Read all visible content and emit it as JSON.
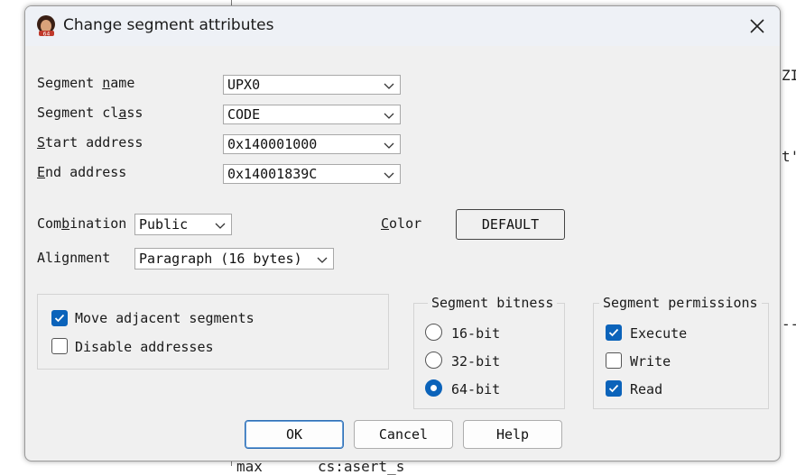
{
  "background": {
    "fragments": [
      "ZI",
      "t'",
      "--",
      "max",
      "cs:asert_s"
    ]
  },
  "dialog": {
    "title": "Change segment attributes",
    "fields": {
      "segment_name": {
        "label_pre": "Segment ",
        "label_u": "n",
        "label_post": "ame",
        "value": "UPX0"
      },
      "segment_class": {
        "label_pre": "Segment cl",
        "label_u": "a",
        "label_post": "ss",
        "value": "CODE"
      },
      "start_address": {
        "label_pre": "",
        "label_u": "S",
        "label_post": "tart address",
        "value": "0x140001000"
      },
      "end_address": {
        "label_pre": "",
        "label_u": "E",
        "label_post": "nd address",
        "value": "0x14001839C"
      }
    },
    "combination": {
      "label_pre": "Com",
      "label_u": "b",
      "label_post": "ination",
      "value": "Public"
    },
    "alignment": {
      "label": "Alignment",
      "value": "Paragraph (16 bytes)"
    },
    "color": {
      "label_u": "C",
      "label_post": "olor",
      "button": "DEFAULT"
    },
    "options": {
      "move_adjacent": {
        "label": "Move adjacent segments",
        "checked": true
      },
      "disable_addresses": {
        "label": "Disable addresses",
        "checked": false
      }
    },
    "bitness": {
      "title": "Segment bitness",
      "options": [
        {
          "label": "16-bit",
          "selected": false
        },
        {
          "label": "32-bit",
          "selected": false
        },
        {
          "label": "64-bit",
          "selected": true
        }
      ]
    },
    "permissions": {
      "title": "Segment permissions",
      "execute": {
        "label": "Execute",
        "checked": true
      },
      "write": {
        "label": "Write",
        "checked": false
      },
      "read": {
        "label": "Read",
        "checked": true
      }
    },
    "buttons": {
      "ok": "OK",
      "cancel": "Cancel",
      "help": "Help"
    },
    "accent_color": "#0b63ba"
  }
}
